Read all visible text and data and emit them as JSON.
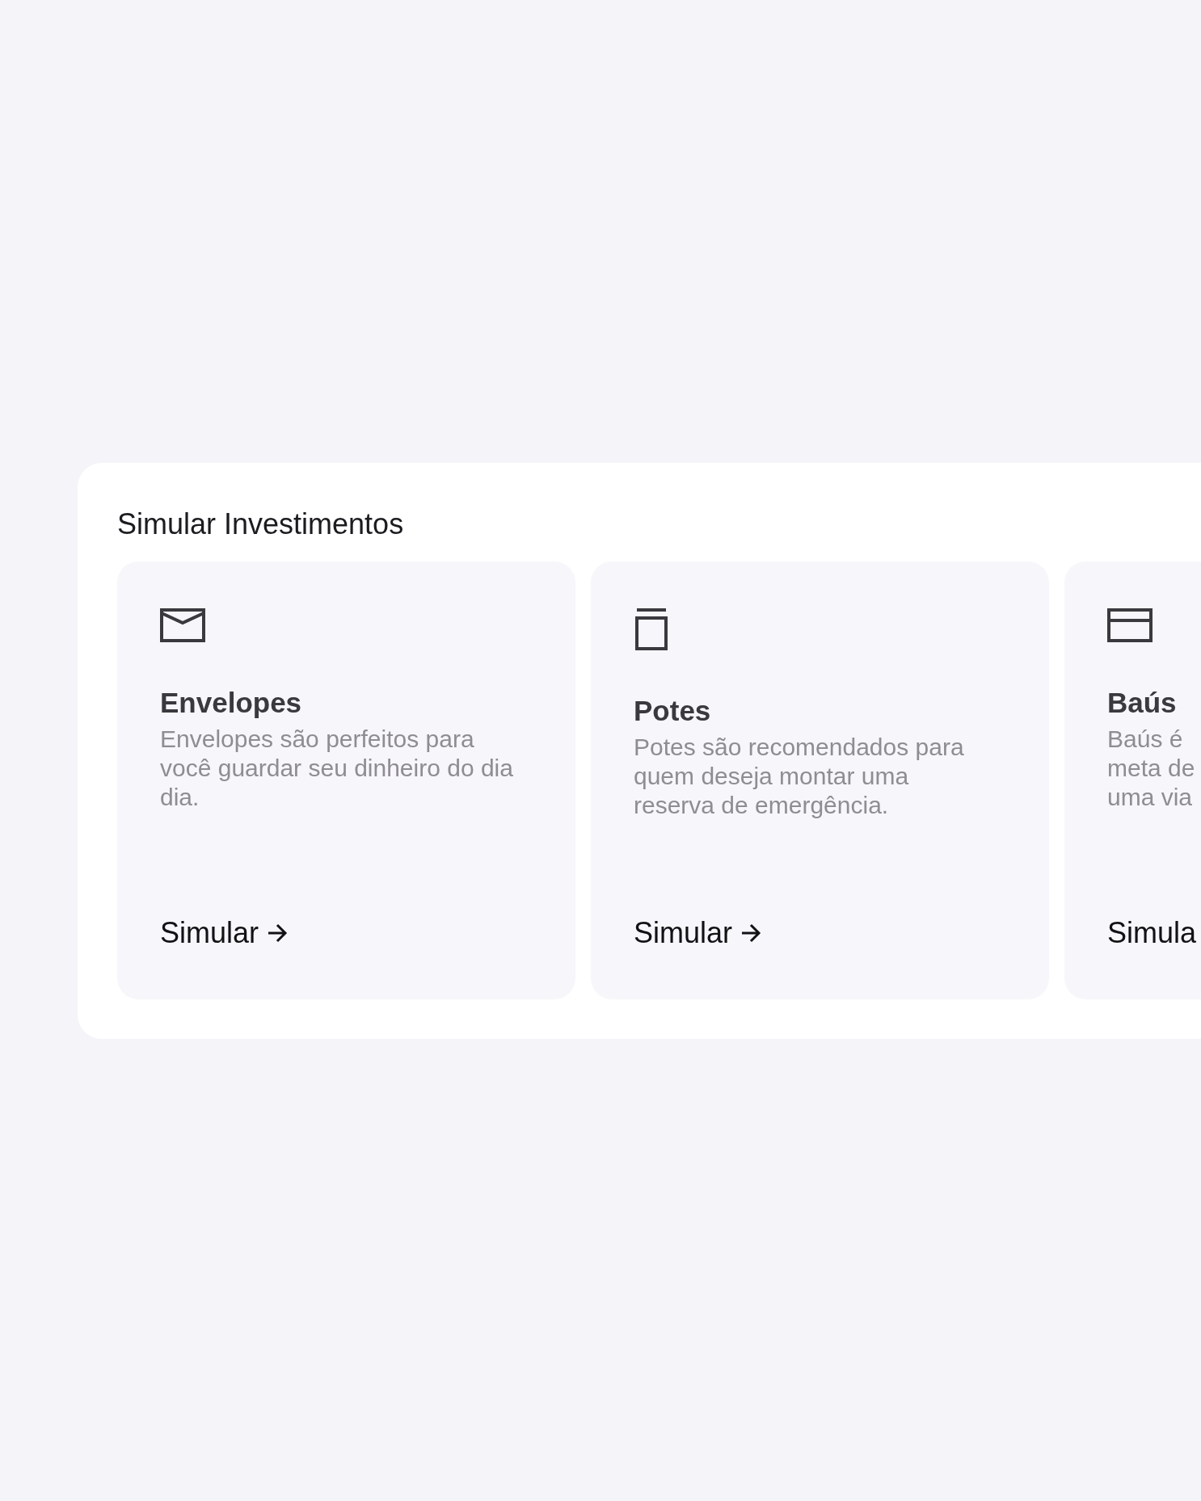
{
  "section": {
    "title": "Simular Investimentos",
    "cards": [
      {
        "kind": "envelope",
        "title": "Envelopes",
        "description_lines": [
          "Envelopes são perfeitos para",
          "você guardar seu dinheiro do dia",
          "dia."
        ],
        "action": "Simular",
        "arrow": true
      },
      {
        "kind": "pot",
        "title": "Potes",
        "description_lines": [
          "Potes são recomendados para",
          "quem deseja montar uma",
          "reserva de emergência."
        ],
        "action": "Simular",
        "arrow": true
      },
      {
        "kind": "chest",
        "title": "Baús",
        "description_lines": [
          "Baús é",
          "meta de",
          "uma via"
        ],
        "action": "Simula",
        "arrow": false
      }
    ]
  }
}
